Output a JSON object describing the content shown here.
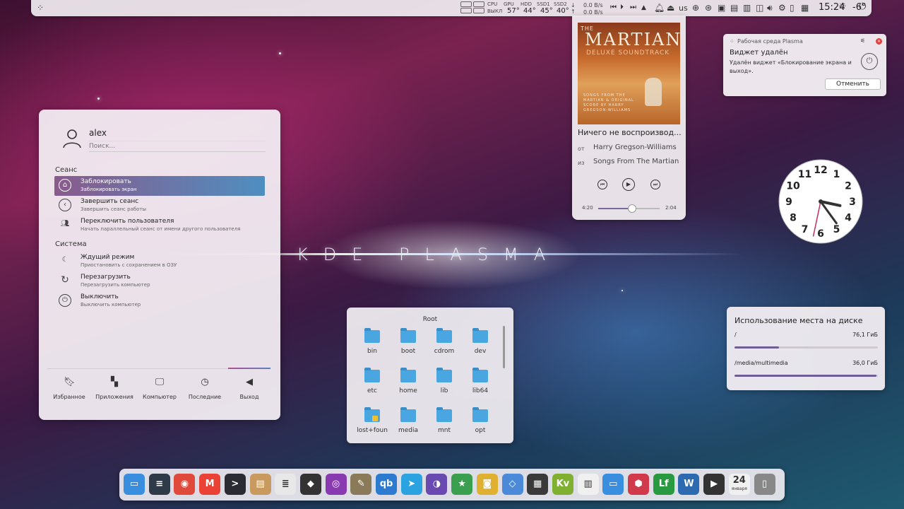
{
  "wallpaper": {
    "title": "KDE PLASMA"
  },
  "top_panel": {
    "menu_icon": "plasma-menu-icon",
    "stats_labels": [
      "CPU",
      "GPU",
      "HDD",
      "SSD1",
      "SSD2"
    ],
    "cpu_status": "ВЫКЛ",
    "temps": [
      "57°",
      "44°",
      "45°",
      "40°"
    ],
    "net_up": "0.0 B/s",
    "net_down": "0.0 B/s",
    "keyboard_layout": "us",
    "clock": "15:24",
    "temperature": "-6°"
  },
  "kickoff": {
    "user": "alex",
    "search_placeholder": "Поиск...",
    "section_session": "Сеанс",
    "section_system": "Система",
    "items": [
      {
        "title": "Заблокировать",
        "subtitle": "Заблокировать экран"
      },
      {
        "title": "Завершить сеанс",
        "subtitle": "Завершить сеанс работы"
      },
      {
        "title": "Переключить пользователя",
        "subtitle": "Начать параллельный сеанс от имени другого пользователя"
      },
      {
        "title": "Ждущий режим",
        "subtitle": "Приостановить с сохранением в ОЗУ"
      },
      {
        "title": "Перезагрузить",
        "subtitle": "Перезагрузить компьютер"
      },
      {
        "title": "Выключить",
        "subtitle": "Выключить компьютер"
      }
    ],
    "tabs": [
      "Избранное",
      "Приложения",
      "Компьютер",
      "Последние",
      "Выход"
    ]
  },
  "media_player": {
    "album_small": "THE",
    "album_title": "MARTIAN",
    "album_subtitle": "DELUXE SOUNDTRACK",
    "album_credits": "SONGS FROM THE MARTIAN & ORIGINAL SCORE BY HARRY GREGSON-WILLIAMS",
    "now_playing": "Ничего не воспроизвод...",
    "by_label": "от",
    "artist": "Harry Gregson-Williams",
    "from_label": "из",
    "album": "Songs From The Martian",
    "time_elapsed": "4:20",
    "time_remaining": "2:04",
    "progress": 0.55
  },
  "notification": {
    "app": "Рабочая среда Plasma",
    "title": "Виджет удалён",
    "body": "Удалён виджет «Блокирование экрана и выход».",
    "action": "Отменить"
  },
  "clock": {
    "hour": 15,
    "minute": 24,
    "second": 32,
    "numbers": [
      "12",
      "1",
      "2",
      "3",
      "4",
      "5",
      "6",
      "7",
      "8",
      "9",
      "10",
      "11"
    ]
  },
  "folder_view": {
    "title": "Root",
    "items": [
      "bin",
      "boot",
      "cdrom",
      "dev",
      "etc",
      "home",
      "lib",
      "lib64",
      "lost+foun",
      "media",
      "mnt",
      "opt"
    ]
  },
  "disk_usage": {
    "title": "Использование места на диске",
    "disks": [
      {
        "mount": "/",
        "size": "76,1 ГиБ",
        "usage": 0.31
      },
      {
        "mount": "/media/multimedia",
        "size": "36,0 ГиБ",
        "usage": 0.99
      }
    ]
  },
  "dock": {
    "apps": [
      {
        "name": "dolphin",
        "color": "#3a8ee0"
      },
      {
        "name": "system-settings",
        "color": "#2f3a48"
      },
      {
        "name": "chrome",
        "color": "#e04a3a"
      },
      {
        "name": "gmail",
        "color": "#ea4335"
      },
      {
        "name": "terminal",
        "color": "#2b2b33"
      },
      {
        "name": "archive",
        "color": "#c89a60"
      },
      {
        "name": "text-editor",
        "color": "#e8e8e8"
      },
      {
        "name": "inkscape",
        "color": "#333333"
      },
      {
        "name": "color-picker",
        "color": "#8a3ab0"
      },
      {
        "name": "gimp",
        "color": "#8a7a5a"
      },
      {
        "name": "qbittorrent",
        "color": "#2d7bd0"
      },
      {
        "name": "telegram",
        "color": "#2aa3e0"
      },
      {
        "name": "github",
        "color": "#6a4ab0"
      },
      {
        "name": "favorites",
        "color": "#3aa050"
      },
      {
        "name": "radio",
        "color": "#e0b030"
      },
      {
        "name": "kstars",
        "color": "#4a8ad8"
      },
      {
        "name": "calculator",
        "color": "#3a3a3a"
      },
      {
        "name": "kvantum",
        "color": "#80b030"
      },
      {
        "name": "screen-settings",
        "color": "#f0f0f0"
      },
      {
        "name": "files",
        "color": "#3a8ee0"
      },
      {
        "name": "security",
        "color": "#d03a4a"
      },
      {
        "name": "lf",
        "color": "#2a9a40"
      },
      {
        "name": "monitor",
        "color": "#2d6ab0"
      },
      {
        "name": "media-player",
        "color": "#333333"
      },
      {
        "name": "calendar",
        "color": "#f0f0f0"
      },
      {
        "name": "trash",
        "color": "#888888"
      }
    ],
    "calendar_day": "24",
    "calendar_month": "января"
  }
}
